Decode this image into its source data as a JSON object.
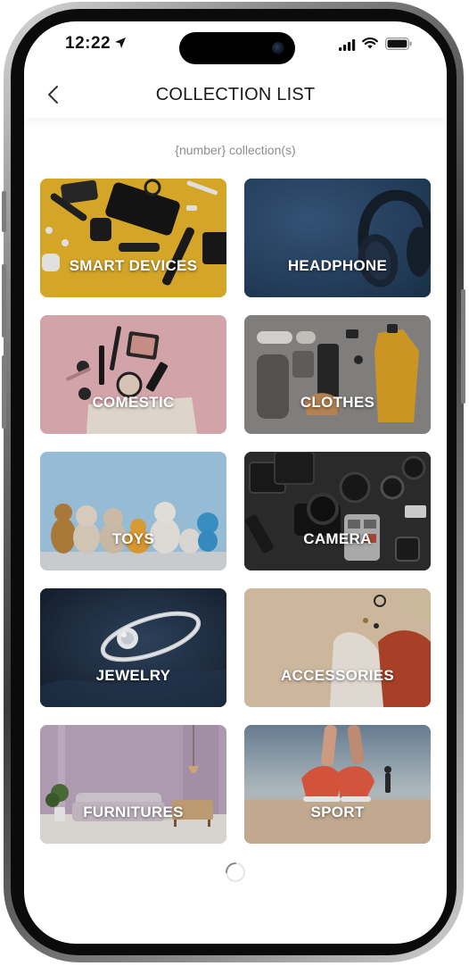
{
  "status_bar": {
    "time": "12:22"
  },
  "nav": {
    "title": "COLLECTION LIST"
  },
  "summary": {
    "count_text": "{number} collection(s)"
  },
  "collections": [
    {
      "label": "SMART DEVICES"
    },
    {
      "label": "HEADPHONE"
    },
    {
      "label": "COMESTIC"
    },
    {
      "label": "CLOTHES"
    },
    {
      "label": "TOYS"
    },
    {
      "label": "CAMERA"
    },
    {
      "label": "JEWELRY"
    },
    {
      "label": "ACCESSORIES"
    },
    {
      "label": "FURNITURES"
    },
    {
      "label": "SPORT"
    }
  ],
  "colors": {
    "title": "#1a1a1a",
    "muted": "#8e8e8e",
    "card_text": "#ffffff"
  }
}
